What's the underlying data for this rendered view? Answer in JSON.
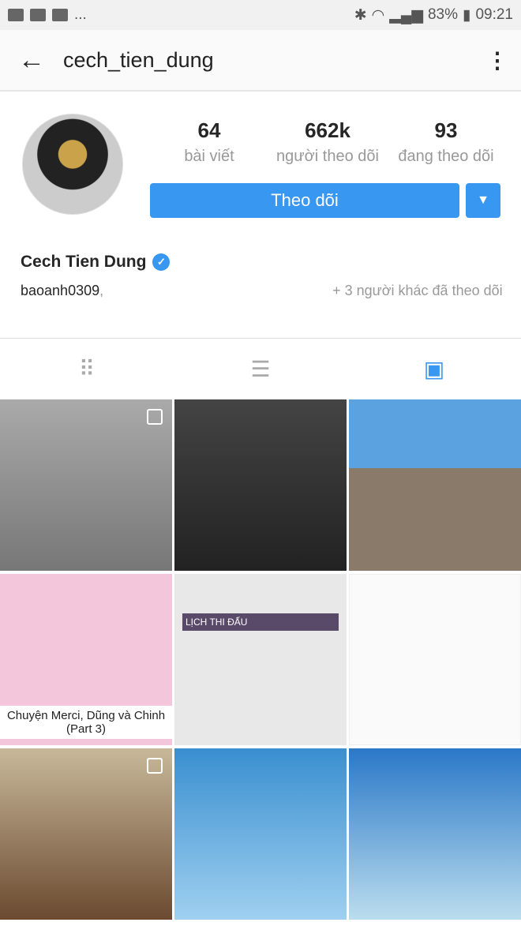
{
  "status_bar": {
    "battery": "83%",
    "time": "09:21",
    "overflow": "..."
  },
  "header": {
    "username": "cech_tien_dung"
  },
  "profile": {
    "stats": [
      {
        "value": "64",
        "label": "bài viết"
      },
      {
        "value": "662k",
        "label": "người theo dõi"
      },
      {
        "value": "93",
        "label": "đang theo dõi"
      }
    ],
    "follow_label": "Theo dõi",
    "full_name": "Cech Tien Dung",
    "followed_by_user": "baoanh0309",
    "followed_by_suffix": "+ 3 người khác đã theo dõi"
  },
  "tabs": [
    {
      "icon": "grid-icon"
    },
    {
      "icon": "list-icon"
    },
    {
      "icon": "tagged-icon",
      "active": true
    }
  ],
  "posts": [
    {
      "bg": "linear-gradient(#aaa,#777)"
    },
    {
      "bg": "linear-gradient(#444,#222)"
    },
    {
      "bg": "linear-gradient(#5aa3e0 0 40%,#8a7a6a 40%)"
    },
    {
      "bg": "#f4c6dc",
      "caption": "Chuyện Merci, Dũng và Chinh (Part 3)"
    },
    {
      "bg": "#e8e8e8",
      "schedule_title": "LỊCH THI ĐẤU"
    },
    {
      "bg": "#fafafa"
    },
    {
      "bg": "linear-gradient(#c8b89a,#6b4a30)"
    },
    {
      "bg": "linear-gradient(#3a8fd0,#9fd0f0)"
    },
    {
      "bg": "linear-gradient(#2a78c8,#bde)"
    }
  ]
}
